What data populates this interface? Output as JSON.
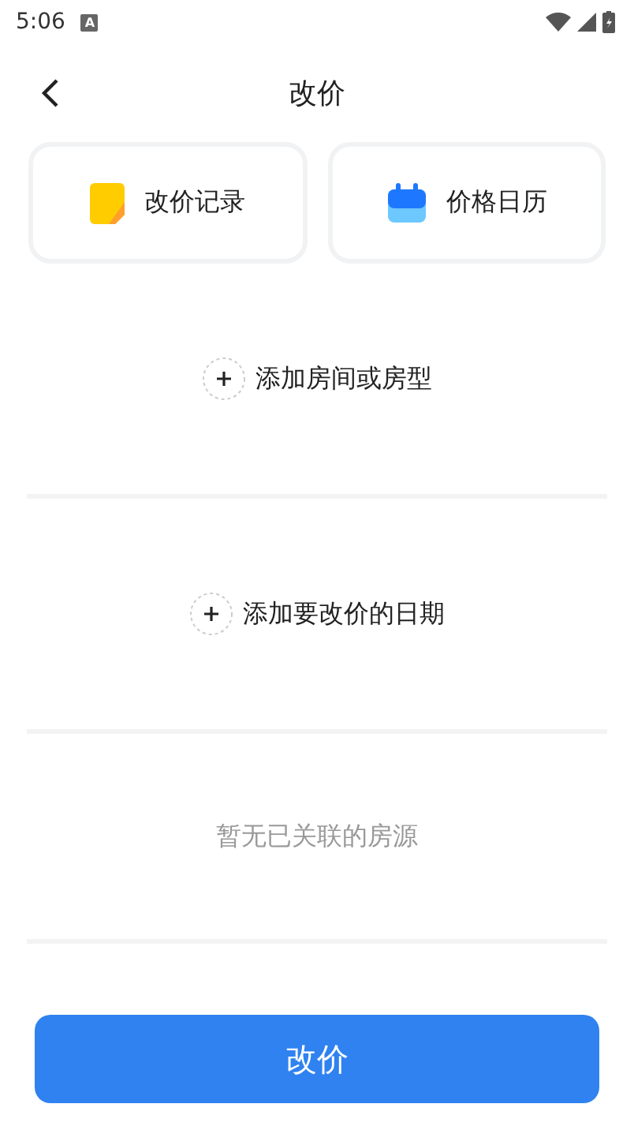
{
  "status_bar": {
    "time": "5:06",
    "notification": "A"
  },
  "header": {
    "title": "改价"
  },
  "shortcuts": [
    {
      "kind": "record",
      "label": "改价记录"
    },
    {
      "kind": "calendar",
      "label": "价格日历"
    }
  ],
  "add_room": {
    "label": "添加房间或房型"
  },
  "add_date": {
    "label": "添加要改价的日期"
  },
  "linked_rooms": {
    "empty_text": "暂无已关联的房源"
  },
  "submit_button": {
    "label": "改价"
  }
}
